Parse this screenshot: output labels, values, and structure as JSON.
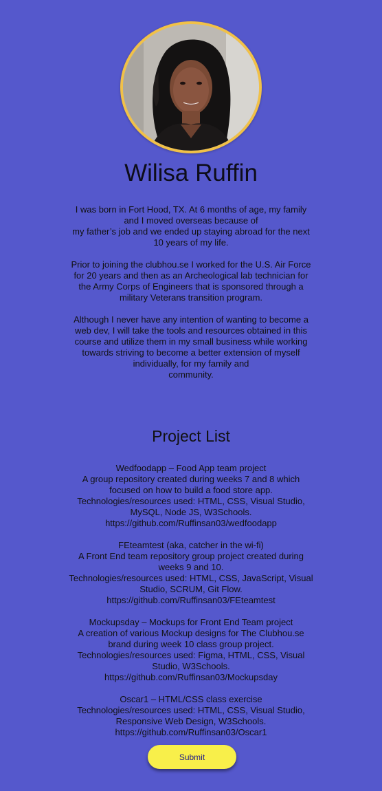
{
  "profile": {
    "name": "Wilisa Ruffin",
    "ring_color": "#f1c148",
    "bio": [
      "I was born in Fort Hood, TX. At 6 months of age, my family and I moved overseas because of\nmy father’s job and we ended up staying abroad for the next 10 years of my life.",
      "Prior to joining the clubhou.se I worked for the U.S. Air Force for 20 years and then as an Archeological lab technician for the Army Corps of Engineers that is sponsored through a military Veterans transition program.",
      "Although I never have any intention of wanting to become a web dev, I will take the tools and resources obtained in this course and utilize them in my small business while working towards striving to become a better extension of myself individually, for my family and\ncommunity."
    ]
  },
  "projects": {
    "title": "Project List",
    "items": [
      {
        "heading": "Wedfoodapp – Food App team project",
        "description": "A group repository created during weeks 7 and 8 which focused on how to build a food store app.",
        "technologies": "Technologies/resources used: HTML, CSS, Visual Studio, MySQL, Node JS, W3Schools.",
        "link": "https://github.com/Ruffinsan03/wedfoodapp"
      },
      {
        "heading": "FEteamtest (aka, catcher in the wi-fi)",
        "description": "A Front End team repository group project created during weeks 9 and 10.",
        "technologies": "Technologies/resources used: HTML, CSS, JavaScript, Visual Studio, SCRUM, Git Flow.",
        "link": "https://github.com/Ruffinsan03/FEteamtest"
      },
      {
        "heading": "Mockupsday – Mockups for Front End Team project",
        "description": "A creation of various Mockup designs for The Clubhou.se brand during week 10 class group project.",
        "technologies": "Technologies/resources used: Figma, HTML, CSS, Visual Studio, W3Schools.",
        "link": "https://github.com/Ruffinsan03/Mockupsday"
      },
      {
        "heading": "Oscar1 – HTML/CSS class exercise",
        "description": "",
        "technologies": "Technologies/resources used: HTML, CSS, Visual Studio, Responsive Web Design, W3Schools.",
        "link": "https://github.com/Ruffinsan03/Oscar1"
      }
    ]
  },
  "submit": {
    "label": "Submit",
    "color": "#f8ef4a"
  },
  "theme": {
    "background": "#5558cc"
  }
}
